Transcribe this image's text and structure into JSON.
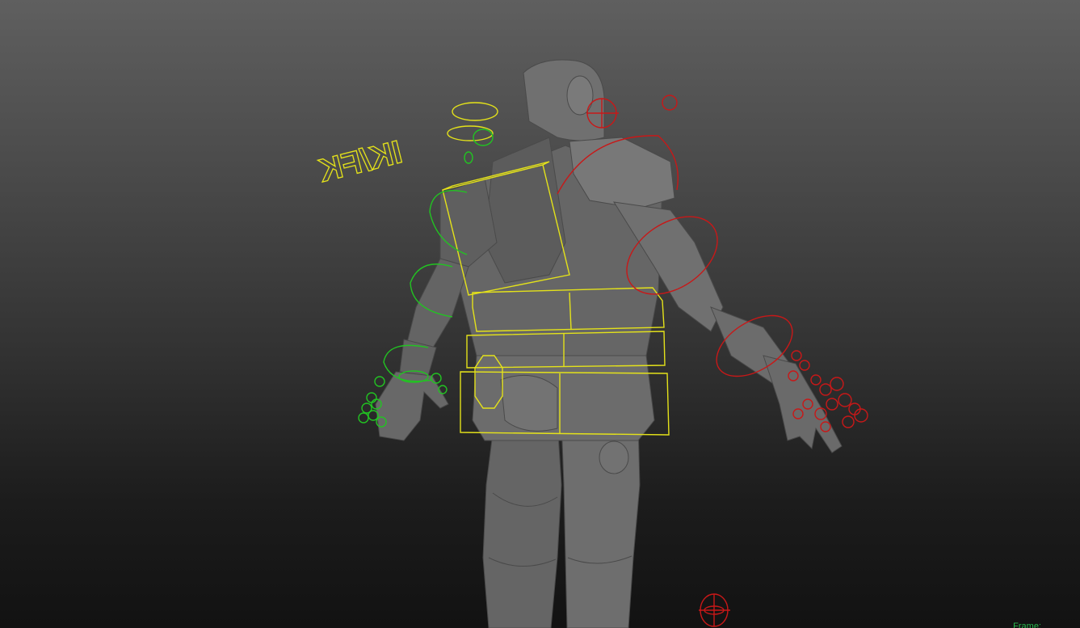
{
  "viewport": {
    "ik_fk_label": "IK/FK",
    "hud_frame_label": "Frame:"
  },
  "colors": {
    "mesh": "#6a6a6a",
    "mesh_dark": "#565656",
    "mesh_light": "#808080",
    "ctrl_center": "#e4e21a",
    "ctrl_left": "#22c322",
    "ctrl_right": "#c81818",
    "hud_text": "#27b84c"
  },
  "icons": {
    "ik_fk_switch": "ik-fk-switch-curve-icon",
    "root_control": "root-ctrl-icon"
  }
}
